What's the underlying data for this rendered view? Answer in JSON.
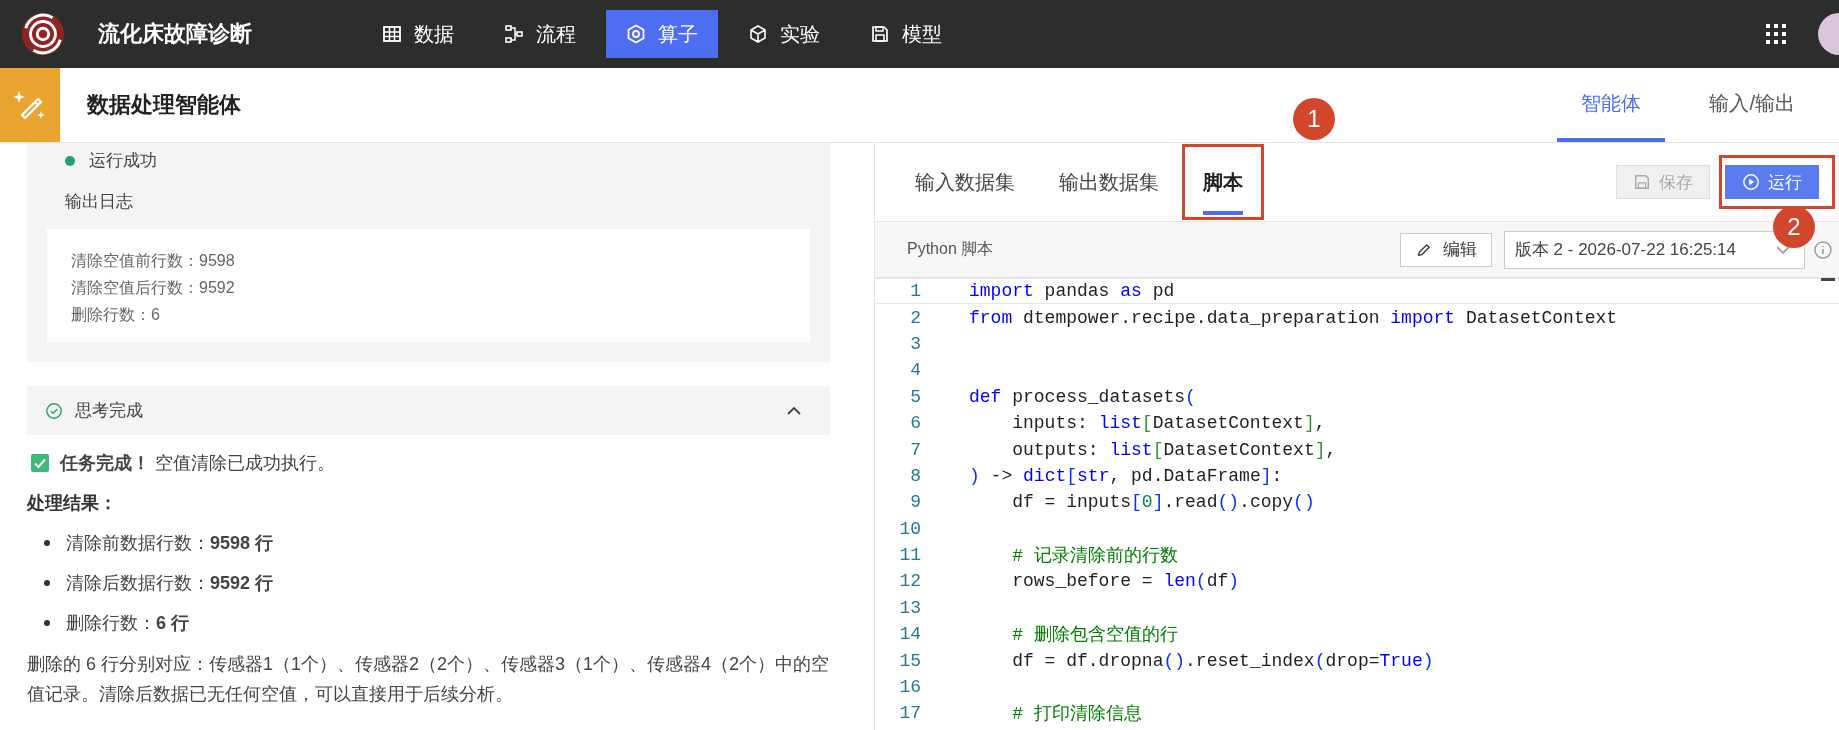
{
  "app": {
    "title": "流化床故障诊断"
  },
  "nav": [
    {
      "label": "数据",
      "selected": false
    },
    {
      "label": "流程",
      "selected": false
    },
    {
      "label": "算子",
      "selected": true
    },
    {
      "label": "实验",
      "selected": false
    },
    {
      "label": "模型",
      "selected": false
    }
  ],
  "page": {
    "title": "数据处理智能体",
    "tabs": [
      {
        "label": "智能体",
        "selected": true
      },
      {
        "label": "输入/输出",
        "selected": false
      }
    ]
  },
  "run_result": {
    "status": "运行成功",
    "log_title": "输出日志",
    "log_lines": [
      "清除空值前行数：9598",
      "清除空值后行数：9592",
      "删除行数：6"
    ]
  },
  "thinking": {
    "title": "思考完成",
    "expanded": true
  },
  "answer": {
    "headline": "**任务完成！** 空值清除已成功执行。",
    "checked": true,
    "section_title": "处理结果：",
    "bullets": [
      "清除前数据行数：**9598 行**",
      "清除后数据行数：**9592 行**",
      "删除行数：**6 行**"
    ],
    "paragraph": "删除的 6 行分别对应：传感器1（1个）、传感器2（2个）、传感器3（1个）、传感器4（2个）中的空值记录。清除后数据已无任何空值，可以直接用于后续分析。"
  },
  "editor_tabs": [
    {
      "label": "输入数据集",
      "selected": false,
      "annotated": false
    },
    {
      "label": "输出数据集",
      "selected": false,
      "annotated": false
    },
    {
      "label": "脚本",
      "selected": true,
      "annotated": true
    }
  ],
  "actions": [
    {
      "label": "保存",
      "disabled": true,
      "annotated": false
    },
    {
      "label": "运行",
      "disabled": false,
      "annotated": true
    }
  ],
  "callouts": [
    {
      "label": "1"
    },
    {
      "label": "2"
    }
  ],
  "script": {
    "title": "Python 脚本",
    "edit_label": "编辑",
    "version": "版本 2 - 2026-07-22 16:25:14"
  },
  "code": [
    {
      "number": "1",
      "tokens": [
        {
          "kind": "kw",
          "text": "import"
        },
        {
          "kind": "plain",
          "text": " pandas "
        },
        {
          "kind": "kw",
          "text": "as"
        },
        {
          "kind": "plain",
          "text": " pd"
        }
      ]
    },
    {
      "number": "2",
      "tokens": [
        {
          "kind": "kw",
          "text": "from"
        },
        {
          "kind": "plain",
          "text": " dtempower.recipe.data_preparation "
        },
        {
          "kind": "kw",
          "text": "import"
        },
        {
          "kind": "plain",
          "text": " DatasetContext"
        }
      ]
    },
    {
      "number": "3"
    },
    {
      "number": "4"
    },
    {
      "number": "5",
      "tokens": [
        {
          "kind": "kw",
          "text": "def"
        },
        {
          "kind": "plain",
          "text": " process_datasets"
        },
        {
          "kind": "b1",
          "text": "("
        }
      ]
    },
    {
      "number": "6",
      "tokens": [
        {
          "kind": "plain",
          "text": "    inputs: "
        },
        {
          "kind": "kw",
          "text": "list"
        },
        {
          "kind": "b2",
          "text": "["
        },
        {
          "kind": "plain",
          "text": "DatasetContext"
        },
        {
          "kind": "b2",
          "text": "]"
        },
        {
          "kind": "plain",
          "text": ","
        }
      ]
    },
    {
      "number": "7",
      "tokens": [
        {
          "kind": "plain",
          "text": "    outputs: "
        },
        {
          "kind": "kw",
          "text": "list"
        },
        {
          "kind": "b2",
          "text": "["
        },
        {
          "kind": "plain",
          "text": "DatasetContext"
        },
        {
          "kind": "b2",
          "text": "]"
        },
        {
          "kind": "plain",
          "text": ","
        }
      ]
    },
    {
      "number": "8",
      "tokens": [
        {
          "kind": "b1",
          "text": ")"
        },
        {
          "kind": "plain",
          "text": " -> "
        },
        {
          "kind": "kw",
          "text": "dict"
        },
        {
          "kind": "b1",
          "text": "["
        },
        {
          "kind": "kw",
          "text": "str"
        },
        {
          "kind": "plain",
          "text": ", pd.DataFrame"
        },
        {
          "kind": "b1",
          "text": "]"
        },
        {
          "kind": "plain",
          "text": ":"
        }
      ]
    },
    {
      "number": "9",
      "tokens": [
        {
          "kind": "plain",
          "text": "    df = inputs"
        },
        {
          "kind": "b1",
          "text": "["
        },
        {
          "kind": "num",
          "text": "0"
        },
        {
          "kind": "b1",
          "text": "]"
        },
        {
          "kind": "plain",
          "text": ".read"
        },
        {
          "kind": "b1",
          "text": "()"
        },
        {
          "kind": "plain",
          "text": ".copy"
        },
        {
          "kind": "b1",
          "text": "()"
        }
      ]
    },
    {
      "number": "10"
    },
    {
      "number": "11",
      "tokens": [
        {
          "kind": "comment",
          "text": "    # 记录清除前的行数"
        }
      ]
    },
    {
      "number": "12",
      "tokens": [
        {
          "kind": "plain",
          "text": "    rows_before = "
        },
        {
          "kind": "kw",
          "text": "len"
        },
        {
          "kind": "b1",
          "text": "("
        },
        {
          "kind": "plain",
          "text": "df"
        },
        {
          "kind": "b1",
          "text": ")"
        }
      ]
    },
    {
      "number": "13"
    },
    {
      "number": "14",
      "tokens": [
        {
          "kind": "comment",
          "text": "    # 删除包含空值的行"
        }
      ]
    },
    {
      "number": "15",
      "tokens": [
        {
          "kind": "plain",
          "text": "    df = df.dropna"
        },
        {
          "kind": "b1",
          "text": "()"
        },
        {
          "kind": "plain",
          "text": ".reset_index"
        },
        {
          "kind": "b1",
          "text": "("
        },
        {
          "kind": "plain",
          "text": "drop="
        },
        {
          "kind": "kw",
          "text": "True"
        },
        {
          "kind": "b1",
          "text": ")"
        }
      ]
    },
    {
      "number": "16"
    },
    {
      "number": "17",
      "tokens": [
        {
          "kind": "comment",
          "text": "    # 打印清除信息"
        }
      ]
    }
  ]
}
